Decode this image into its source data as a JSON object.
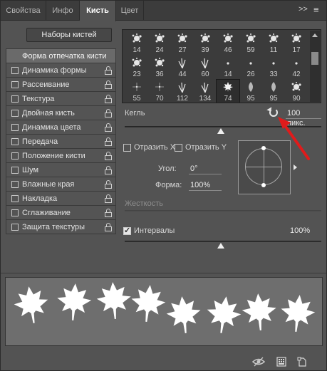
{
  "tabs": [
    {
      "label": "Свойства",
      "active": false
    },
    {
      "label": "Инфо",
      "active": false
    },
    {
      "label": "Кисть",
      "active": true
    },
    {
      "label": "Цвет",
      "active": false
    }
  ],
  "tabbar_icons": {
    "collapse": ">>",
    "menu": "≡"
  },
  "brush_presets_button": "Наборы кистей",
  "options": {
    "header": "Форма отпечатка кисти",
    "items": [
      {
        "label": "Динамика формы",
        "checked": false
      },
      {
        "label": "Рассеивание",
        "checked": false
      },
      {
        "label": "Текстура",
        "checked": false
      },
      {
        "label": "Двойная кисть",
        "checked": false
      },
      {
        "label": "Динамика цвета",
        "checked": false
      },
      {
        "label": "Передача",
        "checked": false
      },
      {
        "label": "Положение кисти",
        "checked": false
      },
      {
        "label": "Шум",
        "checked": false
      },
      {
        "label": "Влажные края",
        "checked": false
      },
      {
        "label": "Накладка",
        "checked": false
      },
      {
        "label": "Сглаживание",
        "checked": false
      },
      {
        "label": "Защита текстуры",
        "checked": false
      }
    ]
  },
  "brush_tips": {
    "sizes": [
      "14",
      "24",
      "27",
      "39",
      "46",
      "59",
      "11",
      "17",
      "23",
      "36",
      "44",
      "60",
      "14",
      "26",
      "33",
      "42",
      "55",
      "70",
      "112",
      "134",
      "74",
      "95",
      "95",
      "90"
    ],
    "selected_index": 20
  },
  "size": {
    "label": "Кегль",
    "value": "100 пикс.",
    "slider_fraction": 0.49
  },
  "flip_x": {
    "label": "Отразить X",
    "checked": false
  },
  "flip_y": {
    "label": "Отразить Y",
    "checked": false
  },
  "angle": {
    "label": "Угол:",
    "value": "0°"
  },
  "roundness": {
    "label": "Форма:",
    "value": "100%"
  },
  "hardness": {
    "label": "Жесткость"
  },
  "spacing": {
    "label": "Интервалы",
    "value": "100%",
    "checked": true,
    "slider_fraction": 0.49
  },
  "colors": {
    "annotation_arrow": "#e01b1b",
    "panel_bg": "#535353",
    "preview_bg": "#6e6e6e"
  },
  "footer_icons": [
    "eye-icon",
    "grid-icon",
    "new-preset-icon"
  ]
}
